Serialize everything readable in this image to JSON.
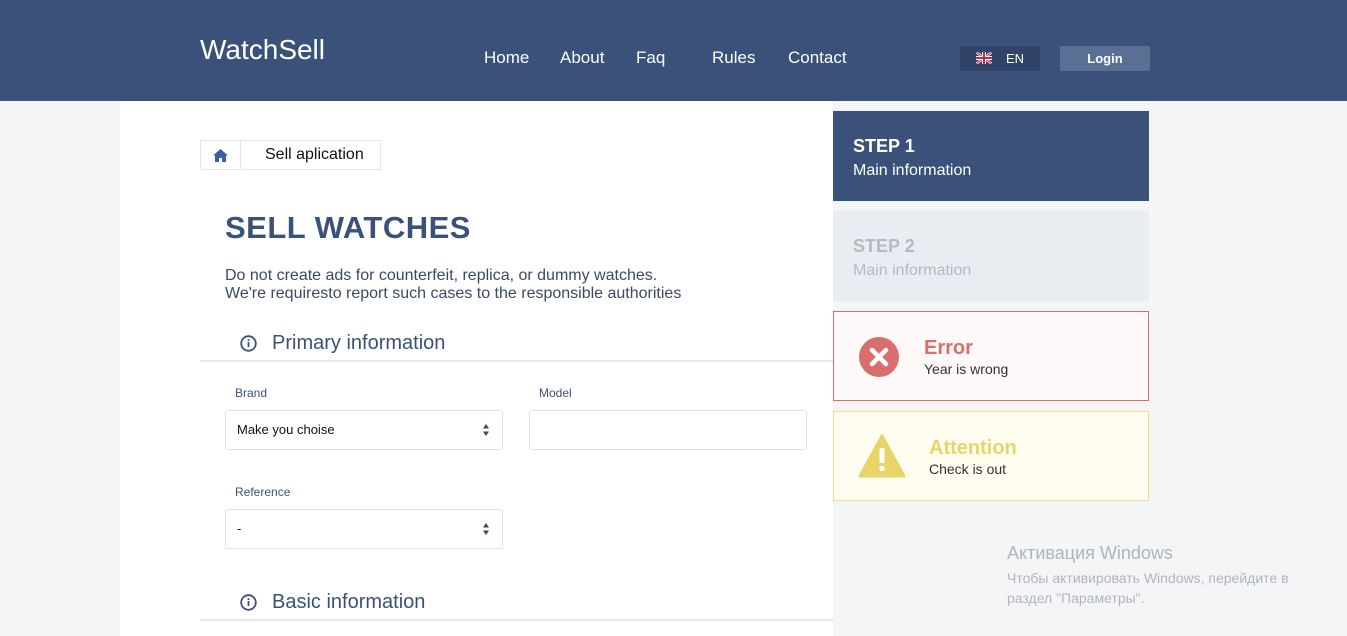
{
  "header": {
    "logo": "WatchSell",
    "nav": [
      "Home",
      "About",
      "Faq",
      "Rules",
      "Contact"
    ],
    "language": "EN",
    "login_label": "Login"
  },
  "breadcrumb": {
    "current": "Sell aplication"
  },
  "page": {
    "title": "SELL WATCHES",
    "description_line1": "Do not create ads for counterfeit, replica, or dummy watches.",
    "description_line2": "We're requiresto report such cases to the responsible authorities"
  },
  "sections": {
    "primary": "Primary information",
    "basic": "Basic information"
  },
  "form": {
    "brand": {
      "label": "Brand",
      "value": "Make you choise"
    },
    "model": {
      "label": "Model",
      "value": ""
    },
    "reference": {
      "label": "Reference",
      "value": "-"
    }
  },
  "steps": [
    {
      "title": "STEP 1",
      "subtitle": "Main information",
      "active": true
    },
    {
      "title": "STEP 2",
      "subtitle": "Main information",
      "active": false
    }
  ],
  "alerts": {
    "error": {
      "title": "Error",
      "text": "Year is wrong",
      "color": "#d96e6e"
    },
    "warning": {
      "title": "Attention",
      "text": "Check is out",
      "color": "#e8d56a"
    }
  },
  "watermark": {
    "line1": "Активация Windows",
    "line2": "Чтобы активировать Windows, перейдите в",
    "line3": "раздел \"Параметры\"."
  }
}
